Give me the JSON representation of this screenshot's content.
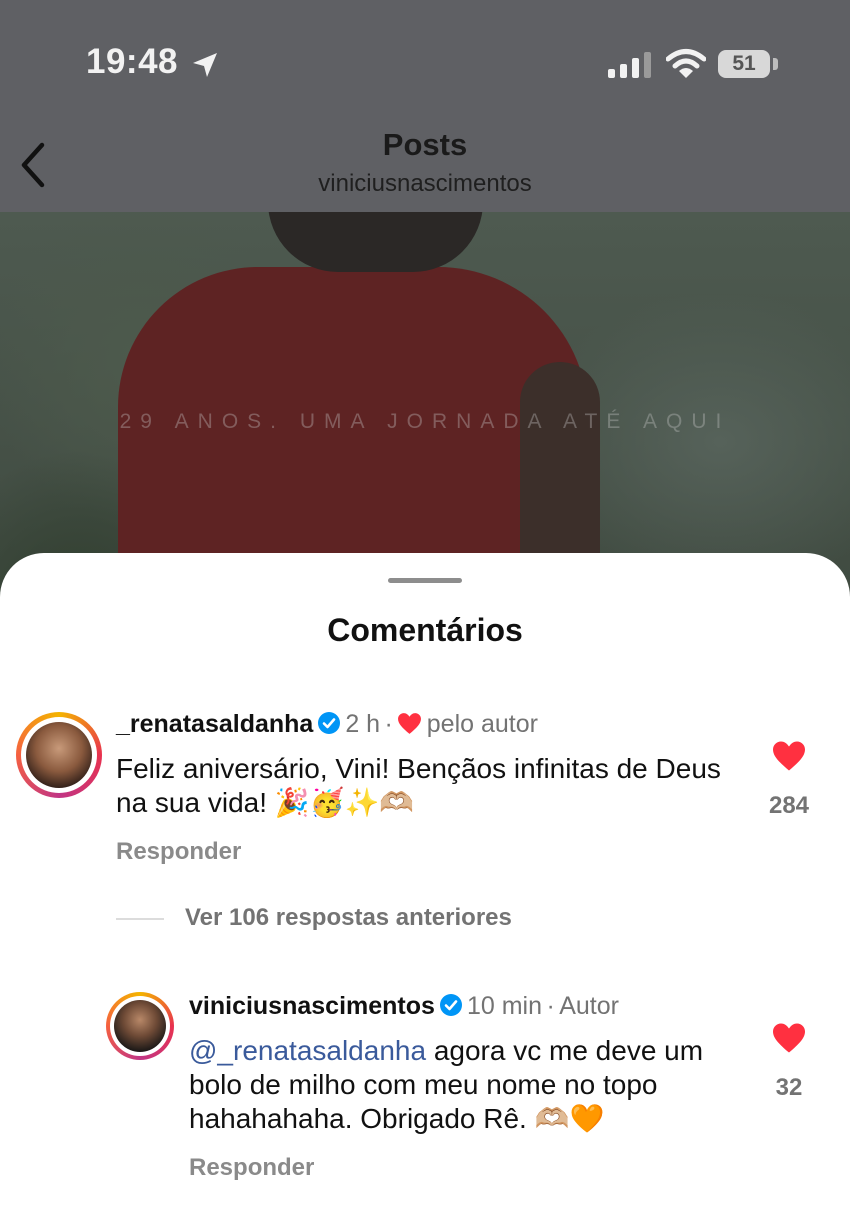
{
  "status_bar": {
    "time": "19:48",
    "battery": "51",
    "icons": [
      "location-arrow-icon",
      "cellular-signal-icon",
      "wifi-icon",
      "battery-icon"
    ]
  },
  "nav": {
    "title": "Posts",
    "subtitle": "viniciusnascimentos",
    "back_icon": "chevron-left-icon"
  },
  "post": {
    "caption": "29 ANOS. UMA JORNADA ATÉ AQUI"
  },
  "comments_sheet": {
    "title": "Comentários",
    "comments": [
      {
        "username": "_renatasaldanha",
        "verified": true,
        "time": "2 h",
        "dot": "·",
        "liked_by_author": "pelo autor",
        "text": "Feliz aniversário, Vini! Bençãos infinitas de Deus na sua vida!",
        "emojis": "🎉🥳✨🫶🏼",
        "reply_label": "Responder",
        "likes": "284"
      }
    ],
    "view_replies": "Ver 106 respostas anteriores",
    "reply": {
      "username": "viniciusnascimentos",
      "verified": true,
      "time": "10 min",
      "dot": "·",
      "author_label": "Autor",
      "mention": "@_renatasaldanha",
      "text": "agora vc me deve um bolo de milho com meu nome no topo hahahahaha. Obrigado Rê.",
      "emojis": "🫶🏼🧡",
      "reply_label": "Responder",
      "likes": "32"
    }
  },
  "colors": {
    "like_red": "#ff3040",
    "verified_blue": "#0095f6",
    "mention_blue": "#3a5a9b"
  }
}
